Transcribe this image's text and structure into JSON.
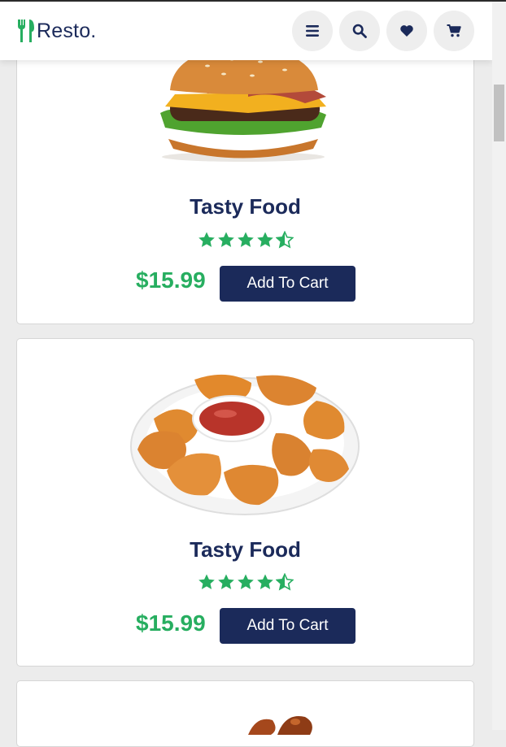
{
  "brand": {
    "name": "Resto.",
    "accent": "#27ae60",
    "navy": "#1b2a5a"
  },
  "header": {
    "buttons": [
      {
        "icon": "menu-icon"
      },
      {
        "icon": "search-icon"
      },
      {
        "icon": "heart-icon"
      },
      {
        "icon": "cart-icon"
      }
    ]
  },
  "products": [
    {
      "image": "burger",
      "title": "Tasty Food",
      "rating": 4.5,
      "price": "$15.99",
      "button": "Add To Cart"
    },
    {
      "image": "chicken-nuggets",
      "title": "Tasty Food",
      "rating": 4.5,
      "price": "$15.99",
      "button": "Add To Cart"
    },
    {
      "image": "chicken-wings"
    }
  ]
}
